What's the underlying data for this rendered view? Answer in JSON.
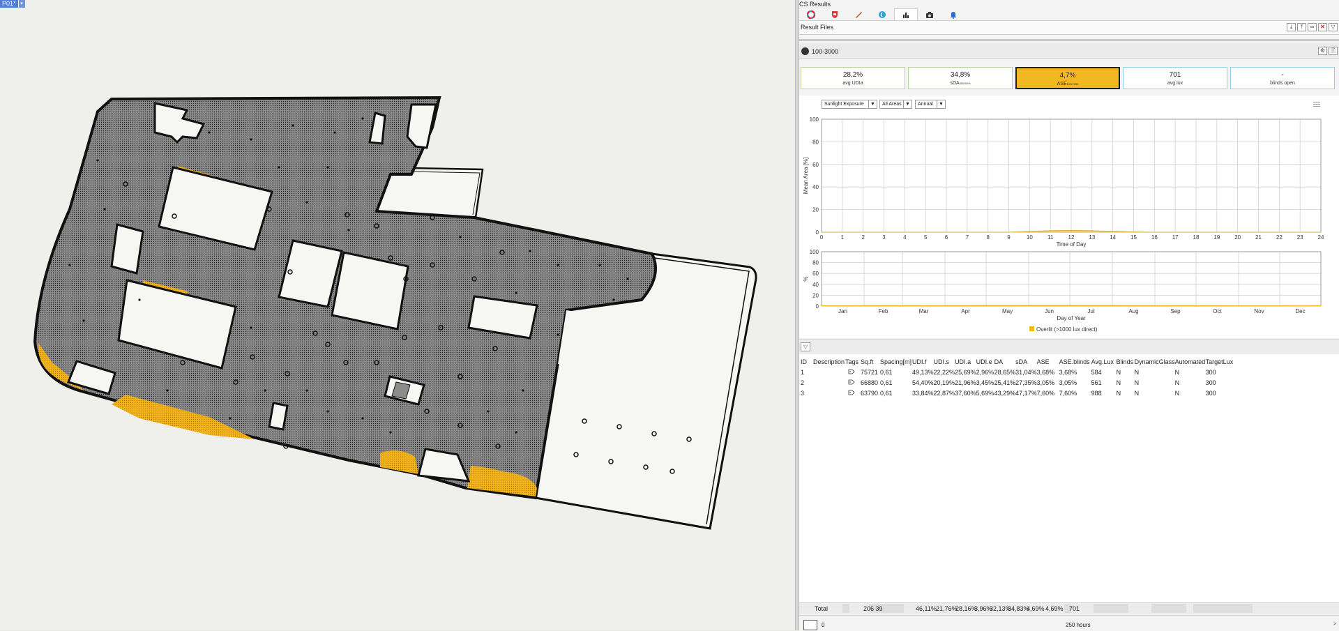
{
  "viewport": {
    "tab_label": "P01*",
    "tab_arrow": "▾"
  },
  "panel": {
    "title": "CS Results",
    "tabs": [
      {
        "icon": "color-wheel-icon",
        "active": false
      },
      {
        "icon": "shield-icon",
        "active": false
      },
      {
        "icon": "pen-icon",
        "active": false
      },
      {
        "icon": "globe-icon",
        "active": false
      },
      {
        "icon": "bar-chart-icon",
        "active": true
      },
      {
        "icon": "camera-icon",
        "active": false
      },
      {
        "icon": "bell-icon",
        "active": false
      }
    ],
    "result_files_label": "Result Files",
    "result_files_buttons": [
      "⤓",
      "⤒",
      "∞",
      "✕",
      "▽"
    ],
    "set_label": "100-3000",
    "set_buttons": [
      "⚙",
      "🗎"
    ]
  },
  "metrics": [
    {
      "value": "28,2%",
      "label": "avg UDIa",
      "sub": "",
      "border": "#b7d39a",
      "bg": "#ffffff"
    },
    {
      "value": "34,8%",
      "label": "sDA",
      "sub": "300/50%",
      "border": "#b7d39a",
      "bg": "#ffffff"
    },
    {
      "value": "4,7%",
      "label": "ASE",
      "sub": "1000/250",
      "border": "#222222",
      "bg": "#f2b822"
    },
    {
      "value": "701",
      "label": "avg lux",
      "sub": "",
      "border": "#8fd1e6",
      "bg": "#ffffff"
    },
    {
      "value": "-",
      "label": "blinds open",
      "sub": "",
      "border": "#8fd1e6",
      "bg": "#ffffff"
    }
  ],
  "chart_controls": {
    "metric": "Sunlight Exposure",
    "area": "All Areas",
    "period": "Annual",
    "arrow": "▼"
  },
  "chart_data": [
    {
      "type": "area",
      "xlabel": "Time of Day",
      "ylabel": "Mean Area [%]",
      "x": [
        0,
        1,
        2,
        3,
        4,
        5,
        6,
        7,
        8,
        9,
        10,
        11,
        12,
        13,
        14,
        15,
        16,
        17,
        18,
        19,
        20,
        21,
        22,
        23,
        24
      ],
      "y": [
        0,
        0,
        0,
        0,
        0,
        0,
        0,
        0,
        0,
        0,
        0.6,
        1.4,
        1.6,
        1.3,
        0.7,
        0.2,
        0,
        0,
        0,
        0,
        0,
        0,
        0,
        0,
        0
      ],
      "xlim": [
        0,
        24
      ],
      "ylim": [
        0,
        100
      ],
      "xticks": [
        "0",
        "1",
        "2",
        "3",
        "4",
        "5",
        "6",
        "7",
        "8",
        "9",
        "10",
        "11",
        "12",
        "13",
        "14",
        "15",
        "16",
        "17",
        "18",
        "19",
        "20",
        "21",
        "22",
        "23",
        "24"
      ],
      "yticks": [
        "0",
        "20",
        "40",
        "60",
        "80",
        "100"
      ],
      "color": "#d8b23a",
      "grid": true
    },
    {
      "type": "area",
      "xlabel": "Day of Year",
      "ylabel": "%",
      "x": [
        1,
        15,
        32,
        46,
        60,
        74,
        91,
        105,
        121,
        135,
        152,
        166,
        182,
        196,
        213,
        227,
        244,
        258,
        274,
        288,
        305,
        319,
        335,
        349,
        365
      ],
      "y": [
        0.6,
        0.7,
        0.8,
        0.9,
        1.0,
        1.0,
        1.1,
        1.2,
        1.3,
        1.3,
        1.4,
        1.4,
        1.4,
        1.3,
        1.3,
        1.2,
        1.1,
        1.0,
        0.9,
        0.8,
        0.7,
        0.6,
        0.6,
        0.5,
        0.6
      ],
      "xlim": [
        1,
        365
      ],
      "ylim": [
        0,
        100
      ],
      "xticks": [
        "Jan",
        "Feb",
        "Mar",
        "Apr",
        "May",
        "Jun",
        "Jul",
        "Aug",
        "Sep",
        "Oct",
        "Nov",
        "Dec"
      ],
      "yticks": [
        "0",
        "20",
        "40",
        "60",
        "80",
        "100"
      ],
      "legend": "Overlit (>1000 lux direct)",
      "color": "#f2b822",
      "grid": true
    }
  ],
  "table": {
    "filter_icon": "▽",
    "headers": [
      "ID",
      "Description",
      "Tags",
      "Sq.ft",
      "Spacing[m]",
      "UDI.f",
      "UDI.s",
      "UDI.a",
      "UDI.e",
      "DA",
      "sDA",
      "ASE",
      "ASE.blinds",
      "Avg.Lux",
      "Blinds",
      "DynamicGlass",
      "Automated",
      "TargetLux"
    ],
    "rows": [
      [
        "1",
        "",
        "tag",
        "75721",
        "0,61",
        "49,13%",
        "22,22%",
        "25,69%",
        "2,96%",
        "28,65%",
        "31,04%",
        "3,68%",
        "3,68%",
        "584",
        "N",
        "N",
        "N",
        "300"
      ],
      [
        "2",
        "",
        "tag",
        "66880",
        "0,61",
        "54,40%",
        "20,19%",
        "21,96%",
        "3,45%",
        "25,41%",
        "27,35%",
        "3,05%",
        "3,05%",
        "561",
        "N",
        "N",
        "N",
        "300"
      ],
      [
        "3",
        "",
        "tag",
        "63790",
        "0,61",
        "33,84%",
        "22,87%",
        "37,60%",
        "5,69%",
        "43,29%",
        "47,17%",
        "7,60%",
        "7,60%",
        "988",
        "N",
        "N",
        "N",
        "300"
      ]
    ],
    "total": {
      "label": "Total",
      "sqft": "206 39",
      "udif": "46,11%",
      "udis": "21,76%",
      "udia": "28,16%",
      "udie": "3,96%",
      "da": "32,13%",
      "sda": "34,83%",
      "ase": "4,69%",
      "aseb": "4,69%",
      "lux": "701"
    }
  },
  "footer": {
    "value": "0",
    "hours": "250 hours",
    "arrow": ">"
  }
}
